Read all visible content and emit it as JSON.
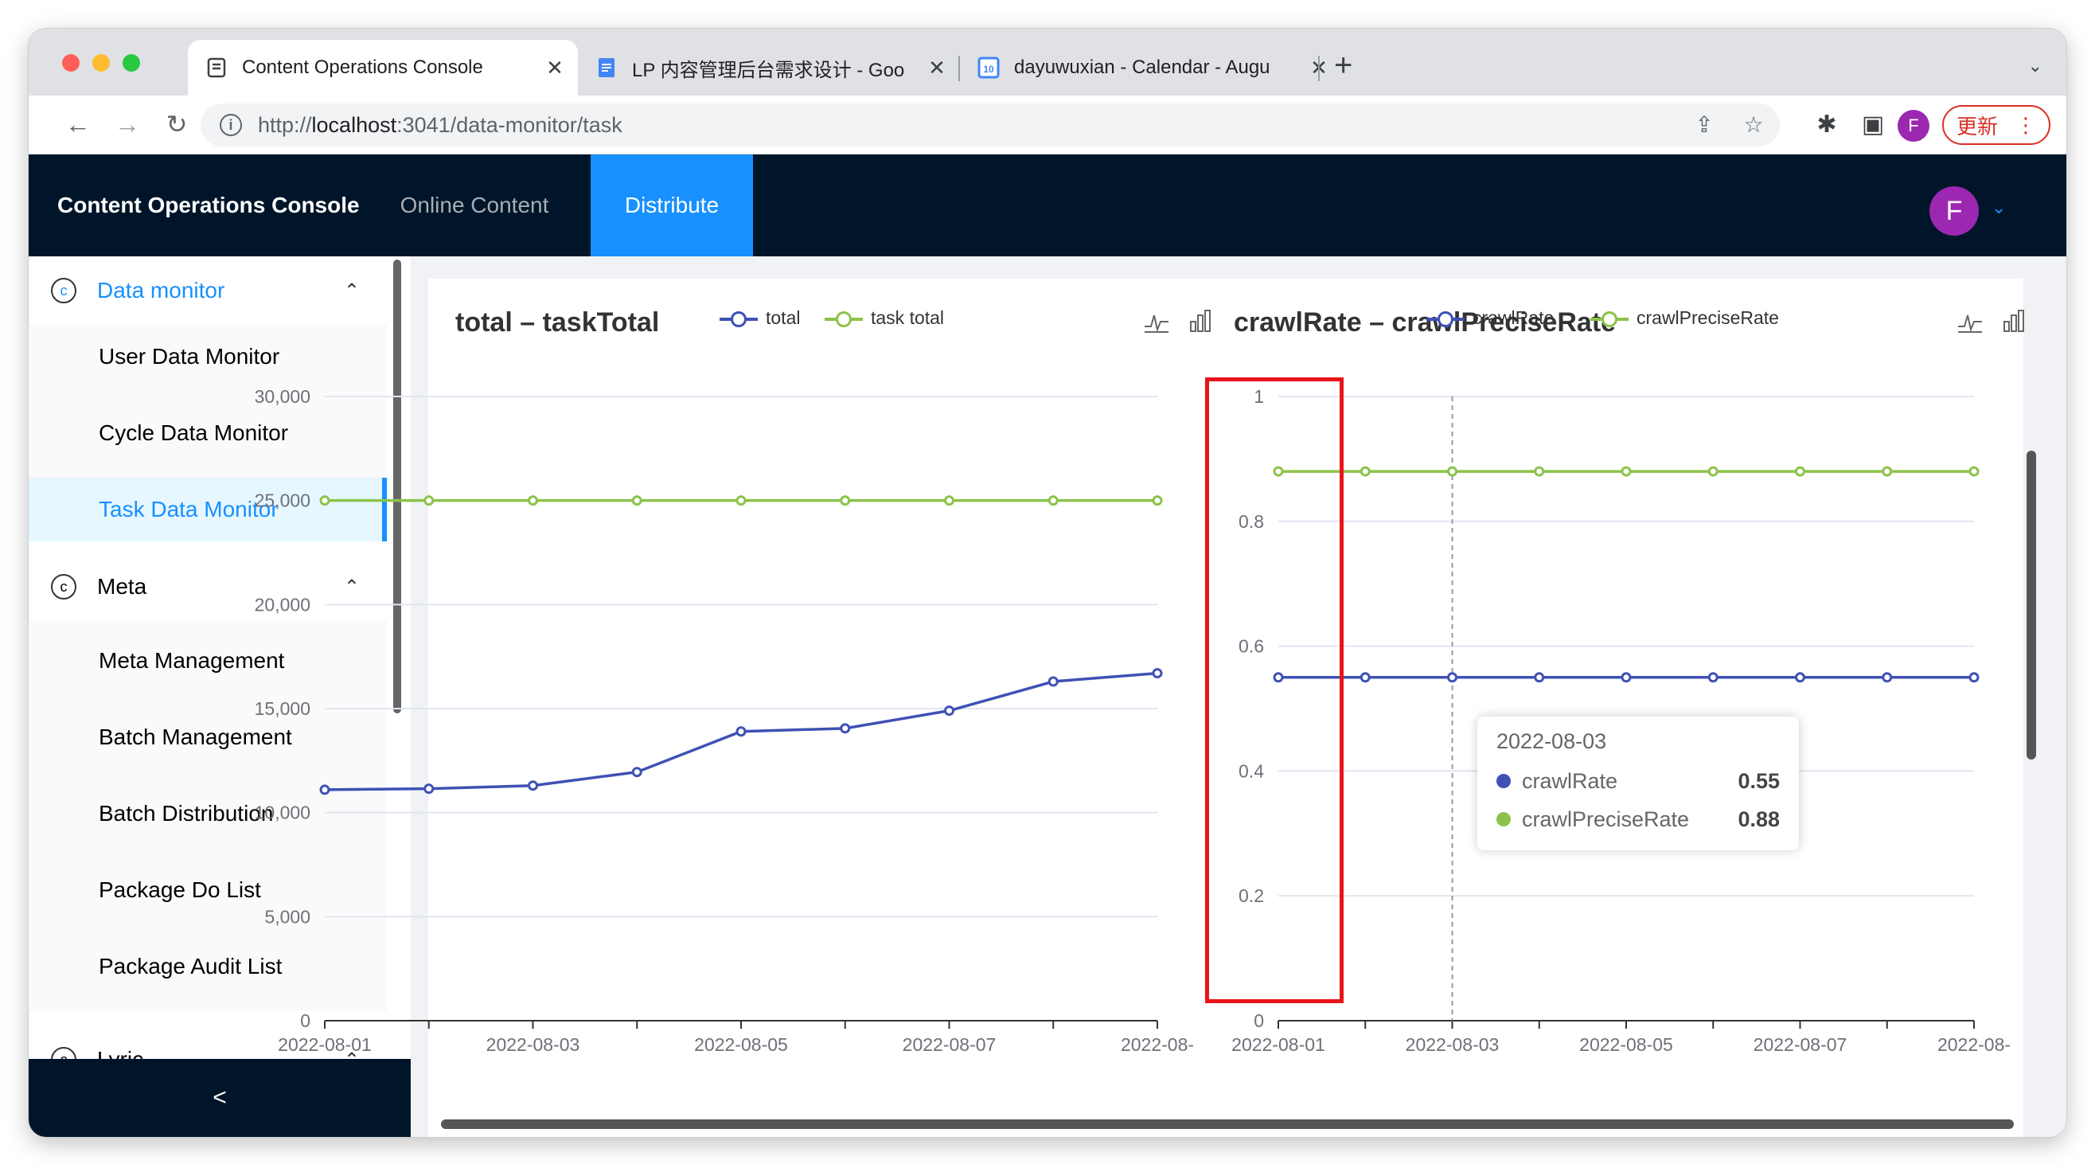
{
  "browser": {
    "tabs": [
      {
        "title": "Content Operations Console",
        "active": true
      },
      {
        "title": "LP 内容管理后台需求设计 - Goo"
      },
      {
        "title": "dayuwuxian - Calendar - Augu"
      }
    ],
    "url_scheme": "http://",
    "url_host": "localhost",
    "url_rest": ":3041/data-monitor/task",
    "profile_initial": "F",
    "update_label": "更新",
    "calendar_icon_day": "10"
  },
  "app": {
    "brand": "Content Operations Console",
    "nav": [
      {
        "label": "Online Content"
      },
      {
        "label": "Distribute",
        "active": true
      }
    ],
    "user_initial": "F"
  },
  "sidebar": {
    "groups": [
      {
        "label": "Data monitor",
        "icon": "copyright-icon",
        "items": [
          "User Data Monitor",
          "Cycle Data Monitor",
          "Task Data Monitor"
        ],
        "active_item": "Task Data Monitor"
      },
      {
        "label": "Meta",
        "icon": "copyright-icon",
        "items": [
          "Meta Management",
          "Batch Management",
          "Batch Distribution",
          "Package Do List",
          "Package Audit List"
        ]
      },
      {
        "label": "Lyric",
        "icon": "copyright-icon"
      }
    ],
    "collapse_label": "<"
  },
  "colors": {
    "blue_series": "#3f51b5",
    "green_series": "#8bc34a",
    "accent": "#1890ff",
    "nav_bg": "#001529",
    "highlight": "#e8141a"
  },
  "chart_data": [
    {
      "type": "line",
      "title": "total – taskTotal",
      "x": [
        "2022-08-01",
        "2022-08-02",
        "2022-08-03",
        "2022-08-04",
        "2022-08-05",
        "2022-08-06",
        "2022-08-07",
        "2022-08-08",
        "2022-08-09"
      ],
      "x_tick_labels": [
        "2022-08-01",
        "2022-08-03",
        "2022-08-05",
        "2022-08-07",
        "2022-08-"
      ],
      "series": [
        {
          "name": "total",
          "values": [
            11100,
            11150,
            11300,
            11950,
            13900,
            14050,
            14900,
            16300,
            16700
          ]
        },
        {
          "name": "task total",
          "values": [
            25000,
            25000,
            25000,
            25000,
            25000,
            25000,
            25000,
            25000,
            25000
          ]
        }
      ],
      "ylim": [
        0,
        30000
      ],
      "y_ticks": [
        "0",
        "5,000",
        "10,000",
        "15,000",
        "20,000",
        "25,000",
        "30,000"
      ],
      "grid": true,
      "legend": "top"
    },
    {
      "type": "line",
      "title": "crawlRate – crawlPreciseRate",
      "x": [
        "2022-08-01",
        "2022-08-02",
        "2022-08-03",
        "2022-08-04",
        "2022-08-05",
        "2022-08-06",
        "2022-08-07",
        "2022-08-08",
        "2022-08-09"
      ],
      "x_tick_labels": [
        "2022-08-01",
        "2022-08-03",
        "2022-08-05",
        "2022-08-07",
        "2022-08-"
      ],
      "series": [
        {
          "name": "crawlRate",
          "values": [
            0.55,
            0.55,
            0.55,
            0.55,
            0.55,
            0.55,
            0.55,
            0.55,
            0.55
          ]
        },
        {
          "name": "crawlPreciseRate",
          "values": [
            0.88,
            0.88,
            0.88,
            0.88,
            0.88,
            0.88,
            0.88,
            0.88,
            0.88
          ]
        }
      ],
      "ylim": [
        0,
        1
      ],
      "y_ticks": [
        "0",
        "0.2",
        "0.4",
        "0.6",
        "0.8",
        "1"
      ],
      "grid": true,
      "legend": "top",
      "tooltip": {
        "date": "2022-08-03",
        "rows": [
          {
            "name": "crawlRate",
            "value": "0.55"
          },
          {
            "name": "crawlPreciseRate",
            "value": "0.88"
          }
        ]
      }
    }
  ]
}
